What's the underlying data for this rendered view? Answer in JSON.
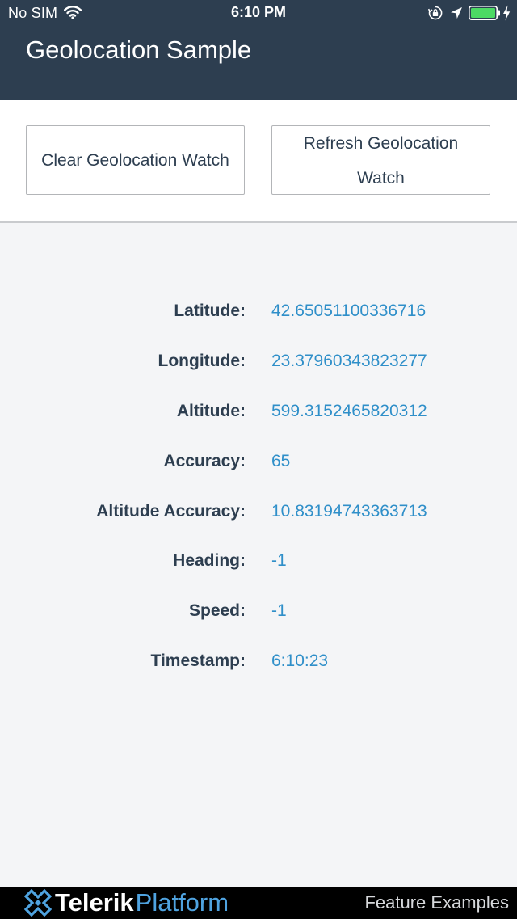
{
  "status_bar": {
    "carrier": "No SIM",
    "time": "6:10 PM",
    "battery_color": "#4cd964"
  },
  "header": {
    "title": "Geolocation Sample",
    "background": "#2d3e50"
  },
  "buttons": {
    "clear_label": "Clear Geolocation Watch",
    "refresh_label": "Refresh Geolocation Watch"
  },
  "fields": [
    {
      "label": "Latitude:",
      "value": "42.65051100336716"
    },
    {
      "label": "Longitude:",
      "value": "23.37960343823277"
    },
    {
      "label": "Altitude:",
      "value": "599.3152465820312"
    },
    {
      "label": "Accuracy:",
      "value": "65"
    },
    {
      "label": "Altitude Accuracy:",
      "value": "10.83194743363713"
    },
    {
      "label": "Heading:",
      "value": "-1"
    },
    {
      "label": "Speed:",
      "value": "-1"
    },
    {
      "label": "Timestamp:",
      "value": "6:10:23"
    }
  ],
  "footer": {
    "brand_primary": "Telerik",
    "brand_secondary": "Platform",
    "right_text": "Feature Examples"
  },
  "colors": {
    "label": "#2d3e50",
    "value": "#2f8fc9",
    "accent": "#4fa3e0"
  },
  "icons": [
    "wifi-icon",
    "lock-rotation-icon",
    "location-arrow-icon",
    "battery-icon",
    "charging-bolt-icon",
    "telerik-logo-icon"
  ]
}
